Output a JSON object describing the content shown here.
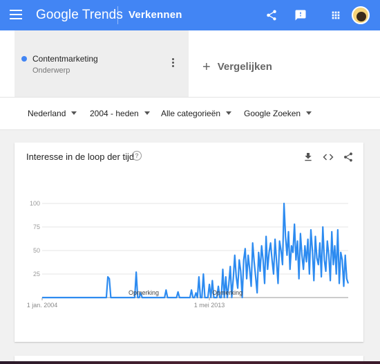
{
  "header": {
    "logo_google": "Google",
    "logo_trends": "Trends",
    "section": "Verkennen",
    "icons": [
      "menu-icon",
      "share-icon",
      "feedback-icon",
      "apps-icon",
      "avatar"
    ]
  },
  "compare": {
    "term": {
      "name": "Contentmarketing",
      "type": "Onderwerp",
      "color": "#4285f4"
    },
    "add_label": "Vergelijken"
  },
  "filters": [
    {
      "label": "Nederland"
    },
    {
      "label": "2004 - heden"
    },
    {
      "label": "Alle categorieën"
    },
    {
      "label": "Google Zoeken"
    }
  ],
  "card": {
    "title": "Interesse in de loop der tijd",
    "help": "?",
    "tools": [
      "download-icon",
      "embed-icon",
      "share-icon"
    ]
  },
  "chart_data": {
    "type": "line",
    "yticks": [
      100,
      75,
      50,
      25
    ],
    "ylim": [
      0,
      100
    ],
    "xticks": [
      {
        "label": "1 jan. 2004",
        "idx": 0
      },
      {
        "label": "1 mei 2013",
        "idx": 112
      }
    ],
    "annotations": [
      {
        "label": "Opmerking",
        "idx": 68
      },
      {
        "label": "Opmerking",
        "idx": 124
      }
    ],
    "series": [
      {
        "color": "#2d8bf0",
        "values": [
          0,
          0,
          0,
          0,
          0,
          0,
          0,
          0,
          0,
          0,
          0,
          0,
          0,
          0,
          0,
          0,
          0,
          0,
          0,
          0,
          0,
          0,
          0,
          0,
          0,
          0,
          0,
          0,
          0,
          0,
          0,
          0,
          0,
          0,
          0,
          0,
          0,
          0,
          0,
          0,
          0,
          0,
          0,
          0,
          22,
          20,
          0,
          0,
          0,
          0,
          0,
          0,
          0,
          0,
          0,
          0,
          0,
          0,
          0,
          0,
          0,
          0,
          0,
          27,
          0,
          0,
          5,
          0,
          0,
          0,
          0,
          0,
          0,
          0,
          0,
          0,
          0,
          0,
          0,
          0,
          0,
          0,
          0,
          8,
          0,
          0,
          0,
          0,
          0,
          0,
          0,
          6,
          0,
          0,
          0,
          0,
          0,
          0,
          0,
          0,
          8,
          0,
          0,
          5,
          0,
          22,
          0,
          0,
          25,
          0,
          0,
          0,
          14,
          0,
          18,
          0,
          0,
          0,
          12,
          0,
          0,
          30,
          0,
          22,
          0,
          14,
          33,
          0,
          20,
          45,
          22,
          10,
          40,
          28,
          0,
          40,
          52,
          20,
          45,
          30,
          12,
          58,
          38,
          22,
          5,
          48,
          28,
          55,
          40,
          15,
          65,
          30,
          48,
          58,
          40,
          25,
          62,
          38,
          15,
          60,
          50,
          35,
          100,
          65,
          45,
          70,
          30,
          55,
          48,
          78,
          40,
          60,
          20,
          68,
          45,
          30,
          55,
          38,
          62,
          25,
          72,
          50,
          18,
          65,
          42,
          35,
          58,
          22,
          75,
          40,
          28,
          60,
          45,
          18,
          70,
          35,
          55,
          25,
          72,
          15,
          48,
          40,
          12,
          45,
          20,
          15
        ]
      }
    ]
  }
}
